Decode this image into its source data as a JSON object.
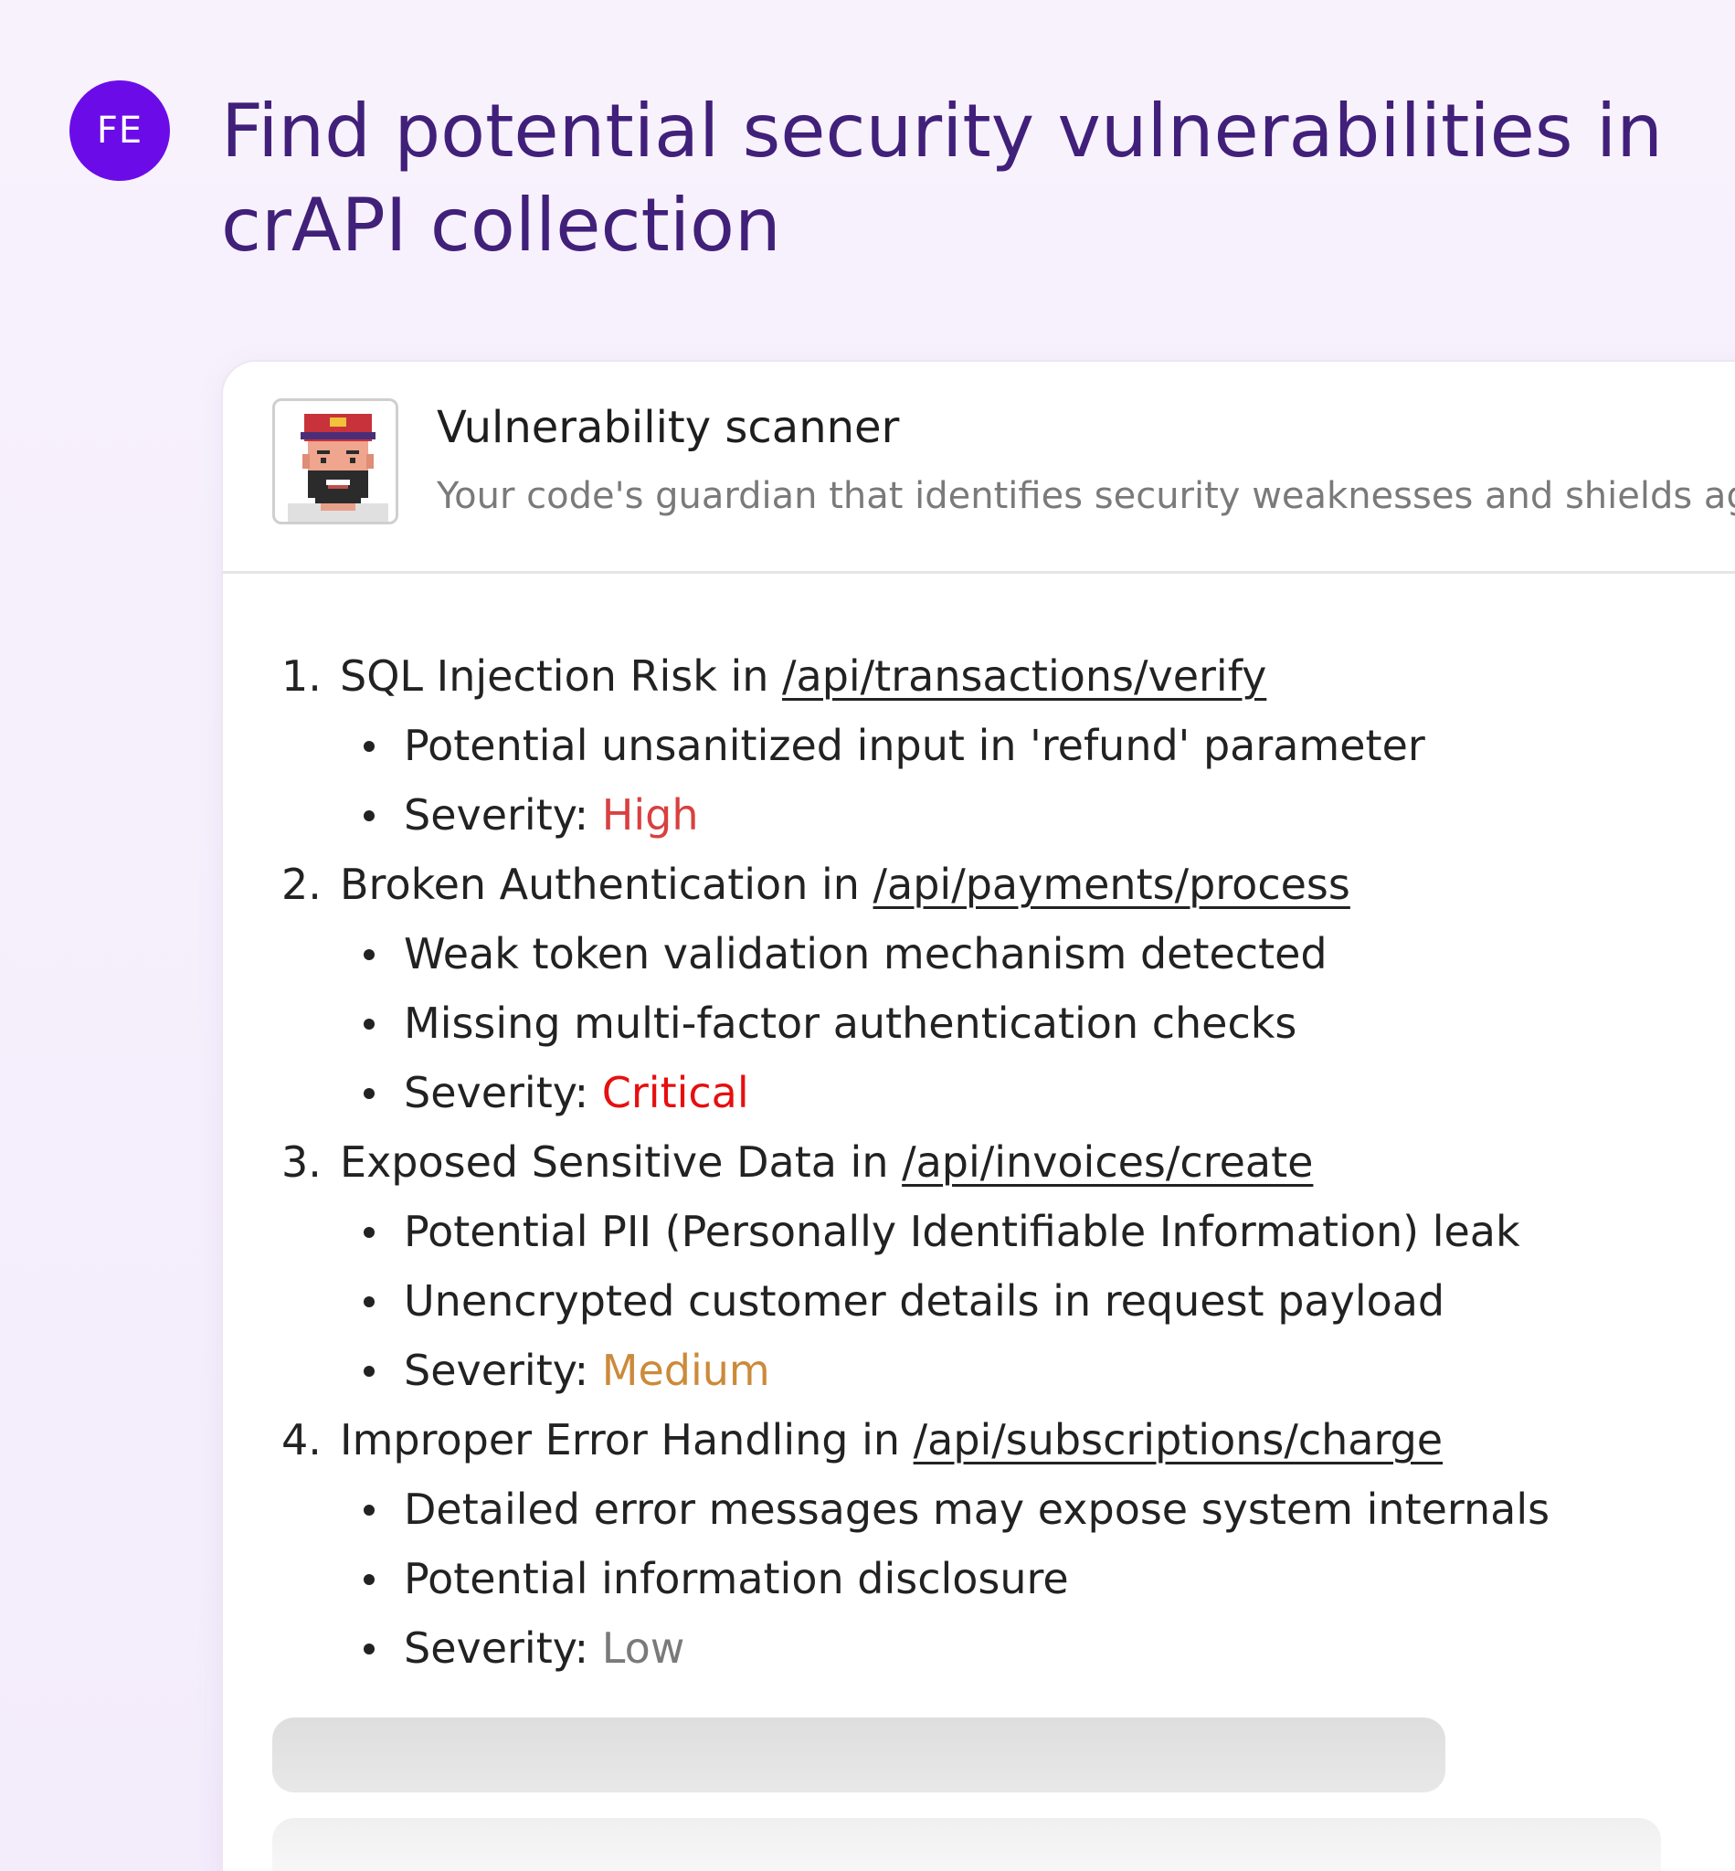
{
  "prompt": {
    "avatar_initials": "FE",
    "text": "Find potential security vulnerabilities in crAPI collection"
  },
  "agent": {
    "name": "Vulnerability scanner",
    "description": "Your code's guardian that identifies security weaknesses and shields aga",
    "avatar_icon": "pixel-art-bearded-man-red-cap"
  },
  "severity_label": "Severity:",
  "findings": [
    {
      "num": "1.",
      "title": "SQL Injection Risk in ",
      "endpoint": "/api/transactions/verify",
      "details": [
        "Potential unsanitized input in 'refund' parameter"
      ],
      "severity": "High",
      "severity_color": "#d94040"
    },
    {
      "num": "2.",
      "title": "Broken Authentication in ",
      "endpoint": "/api/payments/process",
      "details": [
        "Weak token validation mechanism detected",
        "Missing multi-factor authentication checks"
      ],
      "severity": "Critical",
      "severity_color": "#e60f0f"
    },
    {
      "num": "3.",
      "title": "Exposed Sensitive Data in ",
      "endpoint": "/api/invoices/create",
      "details": [
        "Potential PII (Personally Identifiable Information) leak",
        "Unencrypted customer details in request payload"
      ],
      "severity": "Medium",
      "severity_color": "#cc8a3a"
    },
    {
      "num": "4.",
      "title": "Improper Error Handling in ",
      "endpoint": "/api/subscriptions/charge",
      "details": [
        "Detailed error messages may expose system internals",
        "Potential information disclosure"
      ],
      "severity": "Low",
      "severity_color": "#7a7a7a"
    }
  ],
  "colors": {
    "prompt_text": "#41207a",
    "user_avatar": "#6b0ce8",
    "background": "#f8f2fd"
  }
}
